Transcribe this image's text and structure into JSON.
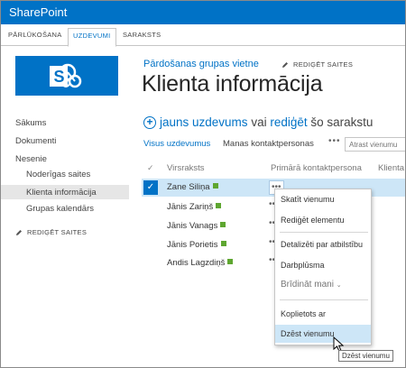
{
  "suite": {
    "brand": "SharePoint"
  },
  "ribbon": {
    "tabs": [
      {
        "label": "PĀRLŪKOŠANA",
        "active": false
      },
      {
        "label": "UZDEVUMI",
        "active": true
      },
      {
        "label": "SARAKSTS",
        "active": false
      }
    ]
  },
  "header": {
    "site_link": "Pārdošanas grupas vietne",
    "edit_links": "REDIĢĒT SAITES",
    "title": "Klienta informācija"
  },
  "left_nav": {
    "items": [
      "Sākums",
      "Dokumenti",
      "Nesenie"
    ],
    "recent": [
      "Noderīgas saites",
      "Klienta informācija",
      "Grupas kalendārs"
    ],
    "edit_links": "REDIĢĒT SAITES"
  },
  "list": {
    "new_item": {
      "prefix": "jauns uzdevums",
      "middle": " vai ",
      "edit": "rediģēt",
      "suffix": " šo sarakstu"
    },
    "views": {
      "all": "Visus uzdevumus",
      "mine": "Manas kontaktpersonas",
      "more": "•••"
    },
    "search_placeholder": "Atrast vienumu",
    "columns": {
      "check": "✓",
      "title": "Virsraksts",
      "contact": "Primārā kontaktpersona",
      "extra": "Klienta"
    },
    "rows": [
      {
        "name": "Zane Siliņa",
        "selected": true
      },
      {
        "name": "Jānis Zariņš",
        "selected": false
      },
      {
        "name": "Jānis Vanags",
        "selected": false
      },
      {
        "name": "Jānis Porietis",
        "selected": false
      },
      {
        "name": "Andis Lagzdiņš",
        "selected": false
      }
    ],
    "ellipsis": "•••"
  },
  "context_menu": {
    "items": [
      "Skatīt vienumu",
      "Rediģēt elementu",
      "Detalizēti par atbilstību",
      "Darbplūsma",
      "Brīdināt mani",
      "Koplietots ar",
      "Dzēst vienumu"
    ],
    "hovered": "Dzēst vienumu"
  },
  "tooltip": "Dzēst vienumu",
  "colors": {
    "accent": "#0072c6",
    "selection": "#cde6f7",
    "new_badge": "#5ea630"
  }
}
